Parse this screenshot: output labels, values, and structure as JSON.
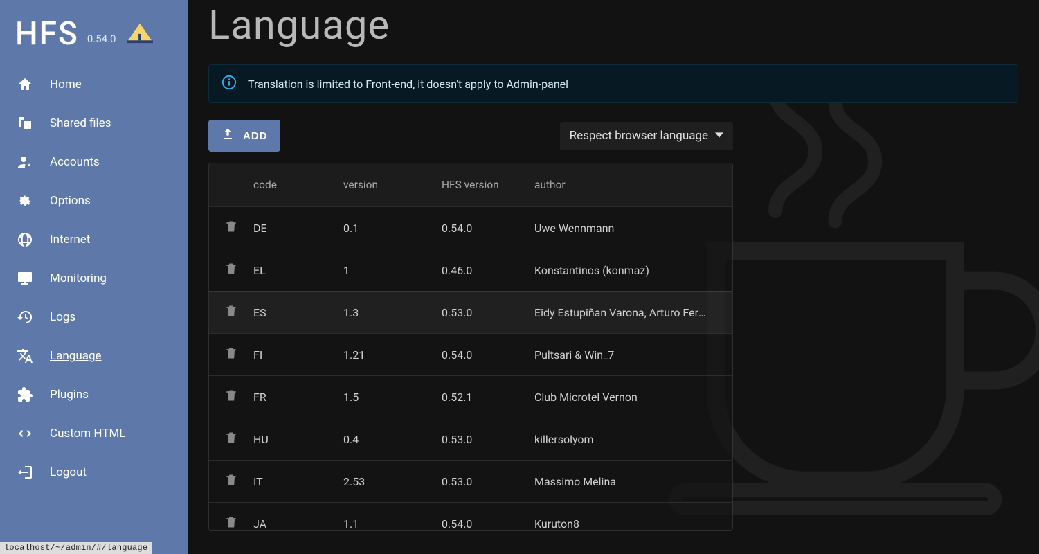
{
  "brand": {
    "name": "HFS",
    "version": "0.54.0"
  },
  "sidebar": {
    "items": [
      {
        "id": "home",
        "label": "Home",
        "icon": "home"
      },
      {
        "id": "shared-files",
        "label": "Shared files",
        "icon": "tree"
      },
      {
        "id": "accounts",
        "label": "Accounts",
        "icon": "account-cog"
      },
      {
        "id": "options",
        "label": "Options",
        "icon": "gear"
      },
      {
        "id": "internet",
        "label": "Internet",
        "icon": "globe"
      },
      {
        "id": "monitoring",
        "label": "Monitoring",
        "icon": "monitor"
      },
      {
        "id": "logs",
        "label": "Logs",
        "icon": "history"
      },
      {
        "id": "language",
        "label": "Language",
        "icon": "translate",
        "active": true
      },
      {
        "id": "plugins",
        "label": "Plugins",
        "icon": "puzzle"
      },
      {
        "id": "custom-html",
        "label": "Custom HTML",
        "icon": "code"
      },
      {
        "id": "logout",
        "label": "Logout",
        "icon": "logout"
      }
    ]
  },
  "page": {
    "title": "Language",
    "info_message": "Translation is limited to Front-end, it doesn't apply to Admin-panel",
    "add_button": "ADD",
    "select_label": "Respect browser language"
  },
  "table": {
    "headers": {
      "code": "code",
      "version": "version",
      "hfs_version": "HFS version",
      "author": "author"
    },
    "rows": [
      {
        "code": "DE",
        "version": "0.1",
        "hfs": "0.54.0",
        "author": "Uwe Wennmann"
      },
      {
        "code": "EL",
        "version": "1",
        "hfs": "0.46.0",
        "author": "Konstantinos (konmaz)"
      },
      {
        "code": "ES",
        "version": "1.3",
        "hfs": "0.53.0",
        "author": "Eidy Estupiñan Varona, Arturo Fernández",
        "selected": true
      },
      {
        "code": "FI",
        "version": "1.21",
        "hfs": "0.54.0",
        "author": "Pultsari & Win_7"
      },
      {
        "code": "FR",
        "version": "1.5",
        "hfs": "0.52.1",
        "author": "Club Microtel Vernon"
      },
      {
        "code": "HU",
        "version": "0.4",
        "hfs": "0.53.0",
        "author": "killersolyom"
      },
      {
        "code": "IT",
        "version": "2.53",
        "hfs": "0.53.0",
        "author": "Massimo Melina"
      },
      {
        "code": "JA",
        "version": "1.1",
        "hfs": "0.54.0",
        "author": "Kuruton8"
      }
    ]
  },
  "status_bar": "localhost/~/admin/#/language"
}
